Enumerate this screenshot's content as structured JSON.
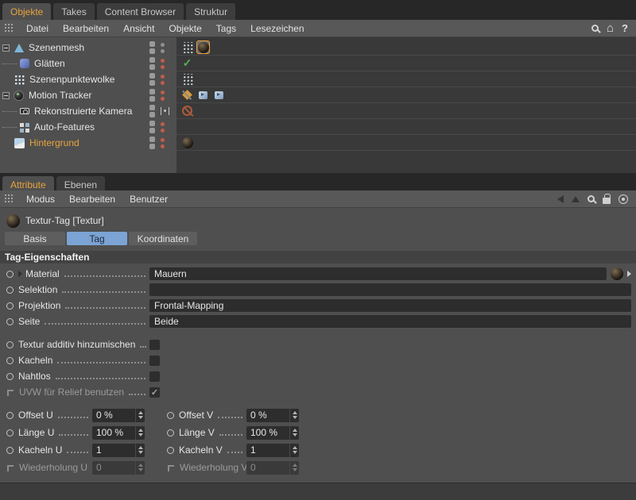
{
  "colors": {
    "accent_orange": "#e8a33d",
    "selection_blue": "#7ba3d4",
    "dot_gray": "#8f8f8f",
    "dot_red": "#bf5c4d",
    "check_green": "#54b054"
  },
  "top": {
    "tabs": [
      {
        "label": "Objekte",
        "active": true
      },
      {
        "label": "Takes",
        "active": false
      },
      {
        "label": "Content Browser",
        "active": false
      },
      {
        "label": "Struktur",
        "active": false
      }
    ],
    "icons_right": [
      "search-icon",
      "home-icon",
      "help-icon"
    ]
  },
  "om": {
    "menu": {
      "items": [
        "Datei",
        "Bearbeiten",
        "Ansicht",
        "Objekte",
        "Tags",
        "Lesezeichen"
      ]
    },
    "rows": [
      {
        "label": "Szenenmesh",
        "depth": 0,
        "expanded": true,
        "icon": "scene-mesh-icon",
        "dot_color": "#8f8f8f",
        "tags": [
          "points-tag",
          "texture-tag-selected"
        ]
      },
      {
        "label": "Glätten",
        "depth": 1,
        "expanded": false,
        "icon": "smoothing-icon",
        "dot_color": "#bf5c4d",
        "tags": [
          "check-tag"
        ]
      },
      {
        "label": "Szenenpunktewolke",
        "depth": 0,
        "expanded": false,
        "icon": "point-cloud-icon",
        "dot_color": "#bf5c4d",
        "tags": [
          "points-tag"
        ]
      },
      {
        "label": "Motion Tracker",
        "depth": 0,
        "expanded": true,
        "icon": "motion-tracker-icon",
        "dot_color": "#bf5c4d",
        "tags": [
          "tracker-marker-tag",
          "camera-solve-tag",
          "camera-solve-tag"
        ]
      },
      {
        "label": "Rekonstruierte Kamera",
        "depth": 1,
        "expanded": false,
        "icon": "camera-icon",
        "toggle": "camera-link",
        "tags": [
          "disabled-sign-tag"
        ]
      },
      {
        "label": "Auto-Features",
        "depth": 1,
        "expanded": false,
        "icon": "auto-features-icon",
        "dot_color": "#bf5c4d",
        "tags": []
      },
      {
        "label": "Hintergrund",
        "depth": 0,
        "expanded": false,
        "icon": "background-icon",
        "dot_color": "#bf5c4d",
        "highlight": true,
        "tags": [
          "texture-tag"
        ]
      }
    ]
  },
  "attr": {
    "tabs": [
      {
        "label": "Attribute",
        "active": true
      },
      {
        "label": "Ebenen",
        "active": false
      }
    ],
    "menu": {
      "items": [
        "Modus",
        "Bearbeiten",
        "Benutzer"
      ]
    },
    "icons_right": [
      "back-icon",
      "up-icon",
      "search-icon",
      "lock-icon",
      "target-icon"
    ],
    "title": "Textur-Tag [Textur]",
    "mode_tabs": [
      {
        "label": "Basis",
        "active": false
      },
      {
        "label": "Tag",
        "active": true
      },
      {
        "label": "Koordinaten",
        "active": false
      }
    ],
    "section": "Tag-Eigenschaften",
    "fields": {
      "material": {
        "label": "Material",
        "value": "Mauern"
      },
      "selektion": {
        "label": "Selektion",
        "value": ""
      },
      "projektion": {
        "label": "Projektion",
        "value": "Frontal-Mapping"
      },
      "seite": {
        "label": "Seite",
        "value": "Beide"
      }
    },
    "checks": [
      {
        "label": "Textur additiv hinzumischen",
        "checked": false,
        "mark": ""
      },
      {
        "label": "Kacheln",
        "checked": false,
        "mark": ""
      },
      {
        "label": "Nahtlos",
        "checked": false,
        "mark": ""
      },
      {
        "label": "UVW für Relief benutzen",
        "checked": true,
        "disabled": true,
        "mark": "✓"
      }
    ],
    "numeric": [
      {
        "l": {
          "label": "Offset U",
          "value": "0 %"
        },
        "r": {
          "label": "Offset V",
          "value": "0 %"
        }
      },
      {
        "l": {
          "label": "Länge U",
          "value": "100 %"
        },
        "r": {
          "label": "Länge V",
          "value": "100 %"
        }
      },
      {
        "l": {
          "label": "Kacheln U",
          "value": "1"
        },
        "r": {
          "label": "Kacheln V",
          "value": "1"
        }
      },
      {
        "l": {
          "label": "Wiederholung U",
          "value": "0",
          "disabled": true
        },
        "r": {
          "label": "Wiederholung V",
          "value": "0",
          "disabled": true
        }
      }
    ]
  }
}
